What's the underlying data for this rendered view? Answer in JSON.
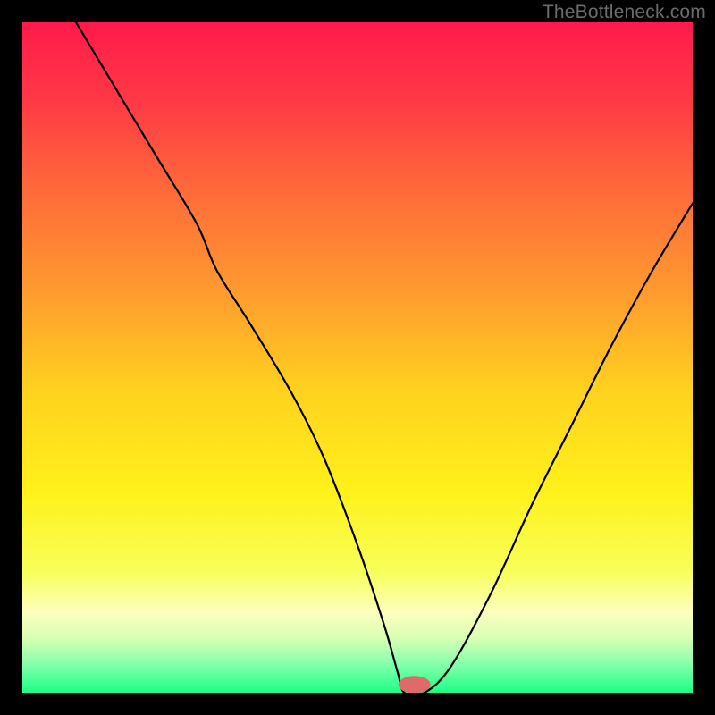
{
  "watermark": "TheBottleneck.com",
  "chart_data": {
    "type": "line",
    "title": "",
    "xlabel": "",
    "ylabel": "",
    "xlim": [
      0,
      100
    ],
    "ylim": [
      0,
      100
    ],
    "grid": false,
    "legend": false,
    "background_gradient": {
      "stops": [
        {
          "offset": 0.0,
          "color": "#ff1a4b"
        },
        {
          "offset": 0.12,
          "color": "#ff3a45"
        },
        {
          "offset": 0.25,
          "color": "#ff6a3a"
        },
        {
          "offset": 0.4,
          "color": "#ff9a2f"
        },
        {
          "offset": 0.55,
          "color": "#ffd21f"
        },
        {
          "offset": 0.7,
          "color": "#fff11a"
        },
        {
          "offset": 0.82,
          "color": "#f8ff5a"
        },
        {
          "offset": 0.88,
          "color": "#fdffbe"
        },
        {
          "offset": 0.92,
          "color": "#d6ffb4"
        },
        {
          "offset": 0.96,
          "color": "#7fffaa"
        },
        {
          "offset": 1.0,
          "color": "#1aff86"
        }
      ]
    },
    "series": [
      {
        "name": "bottleneck-curve",
        "x": [
          8,
          14,
          20,
          26,
          29,
          34,
          40,
          45,
          50,
          54,
          56,
          57,
          60,
          64,
          70,
          76,
          82,
          88,
          94,
          100
        ],
        "y": [
          100,
          90,
          80,
          70,
          63,
          55,
          45,
          35,
          22,
          10,
          3,
          0,
          0,
          4,
          15,
          28,
          40,
          52,
          63,
          73
        ]
      }
    ],
    "marker": {
      "name": "optimum-marker",
      "x": 58.5,
      "y": 1.2,
      "color": "#e06a6a",
      "rx": 2.4,
      "ry": 1.3
    }
  }
}
